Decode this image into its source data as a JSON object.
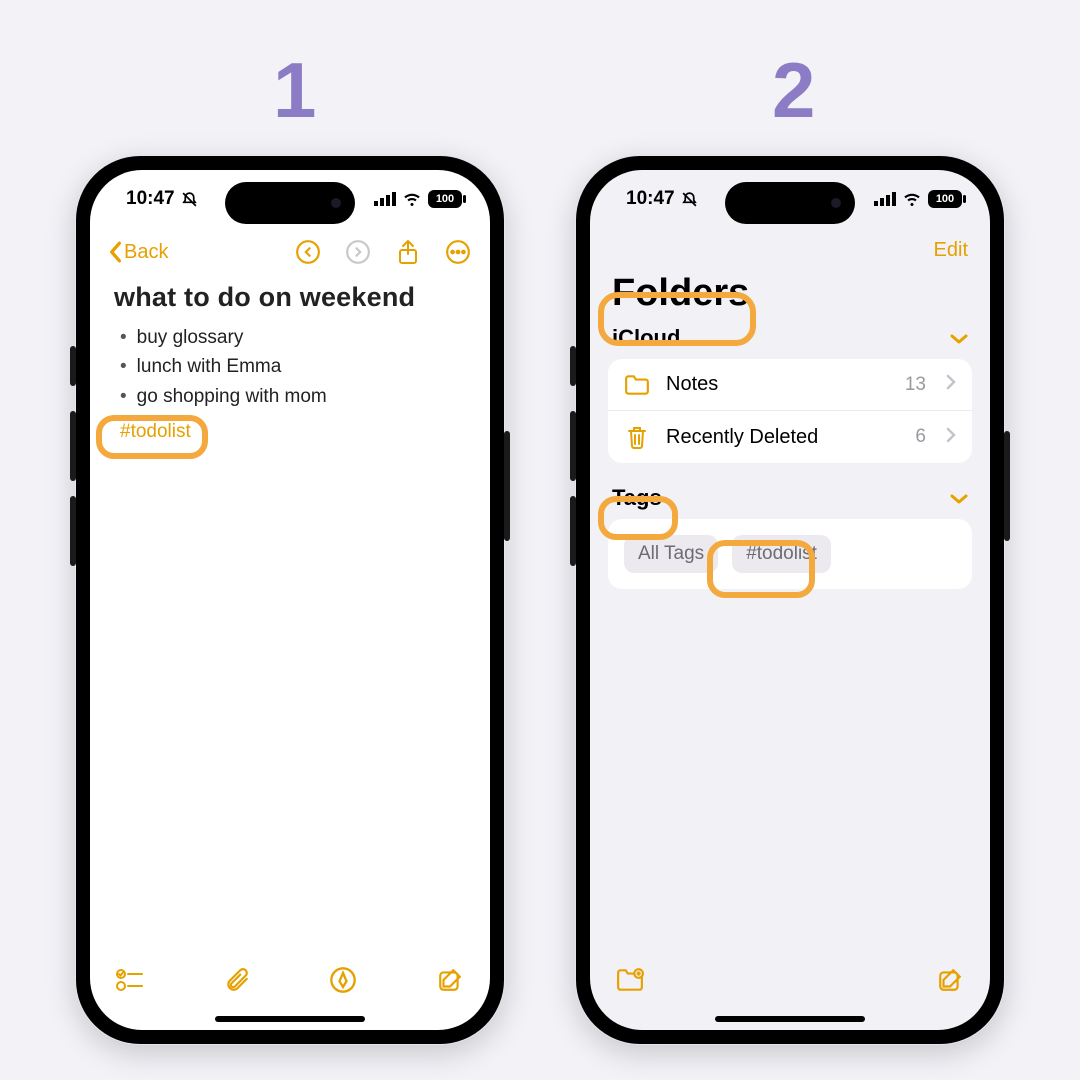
{
  "steps": {
    "one": "1",
    "two": "2"
  },
  "status": {
    "time": "10:47",
    "battery": "100"
  },
  "phone1": {
    "back": "Back",
    "title": "what to do on weekend",
    "bullets": [
      "buy glossary",
      "lunch with Emma",
      "go shopping with mom"
    ],
    "tag": "#todolist"
  },
  "phone2": {
    "edit": "Edit",
    "title": "Folders",
    "section": "iCloud",
    "rows": [
      {
        "label": "Notes",
        "count": "13"
      },
      {
        "label": "Recently Deleted",
        "count": "6"
      }
    ],
    "tags_title": "Tags",
    "tags": [
      "All Tags",
      "#todolist"
    ]
  }
}
